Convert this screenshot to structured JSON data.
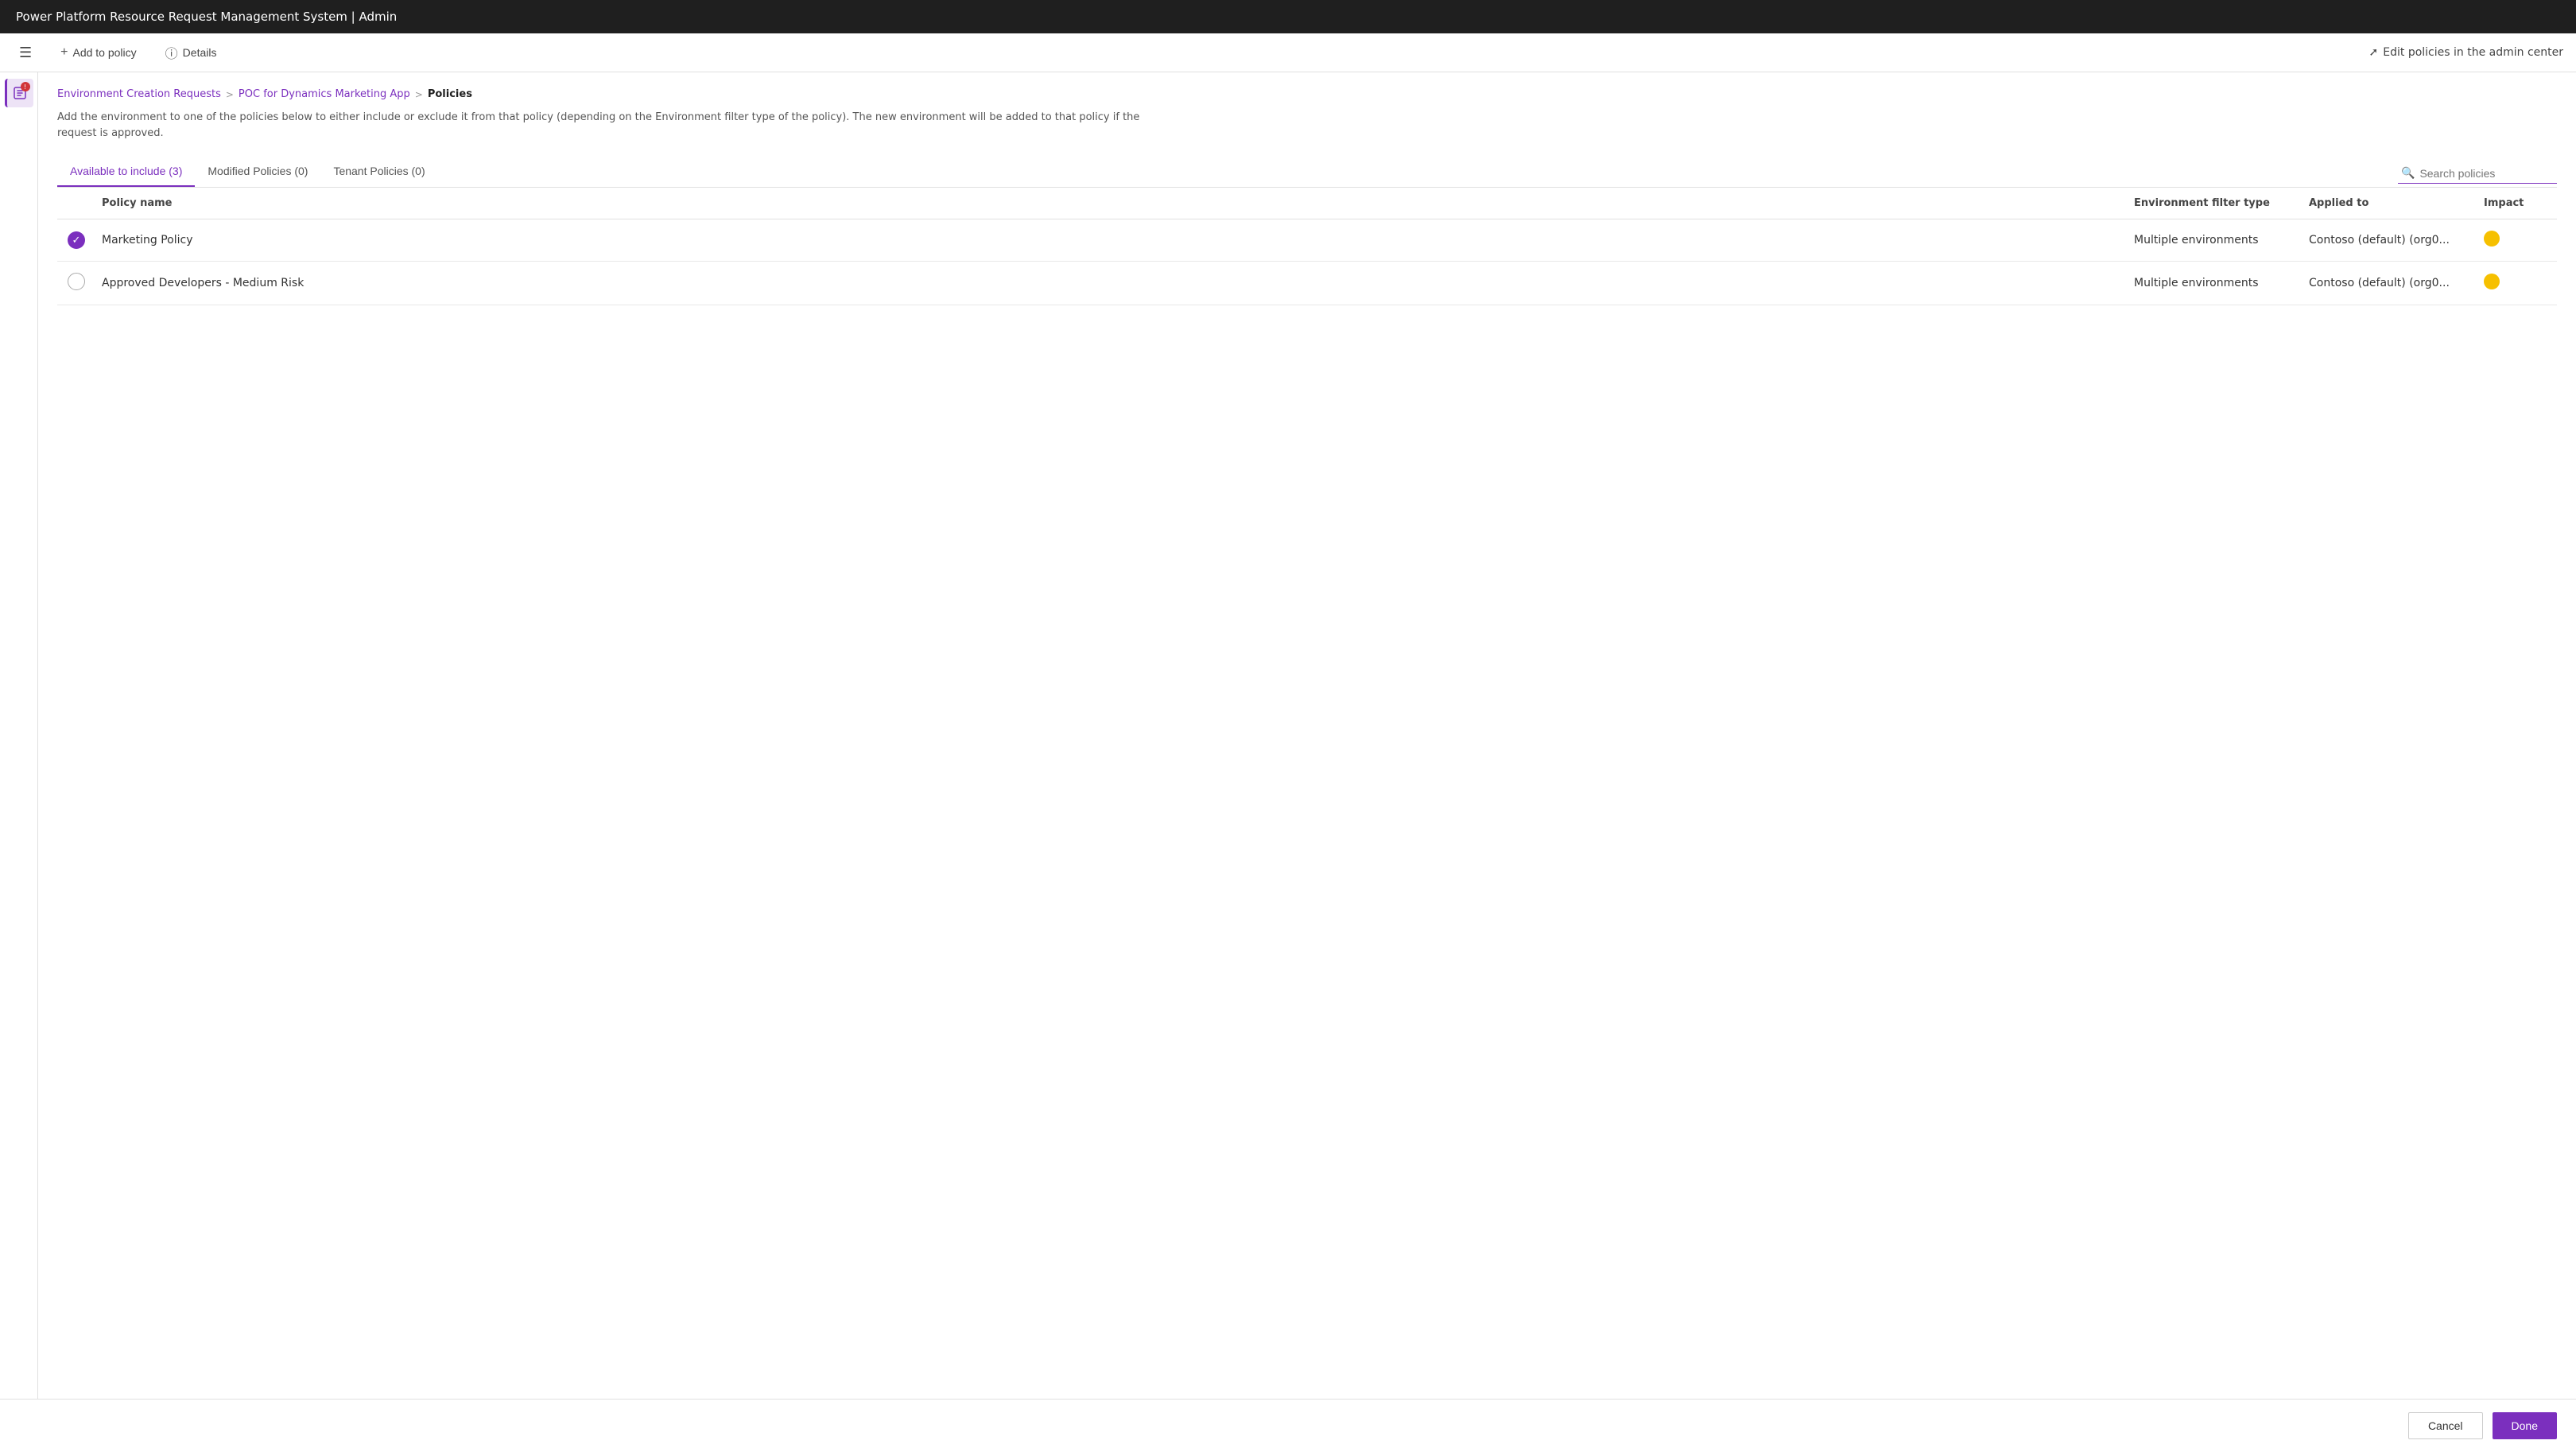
{
  "titleBar": {
    "title": "Power Platform Resource Request Management System | Admin"
  },
  "toolbar": {
    "menu_icon": "≡",
    "add_to_policy_label": "Add to policy",
    "details_label": "Details",
    "edit_link_label": "Edit policies in the admin center"
  },
  "breadcrumb": {
    "step1": "Environment Creation Requests",
    "step2": "POC for Dynamics Marketing App",
    "step3": "Policies"
  },
  "description": "Add the environment to one of the policies below to either include or exclude it from that policy (depending on the Environment filter type of the policy). The new environment will be added to that policy if the request is approved.",
  "tabs": [
    {
      "label": "Available to include (3)",
      "active": true
    },
    {
      "label": "Modified Policies (0)",
      "active": false
    },
    {
      "label": "Tenant Policies (0)",
      "active": false
    }
  ],
  "search": {
    "placeholder": "Search policies"
  },
  "table": {
    "columns": [
      {
        "id": "select",
        "label": ""
      },
      {
        "id": "policy_name",
        "label": "Policy name"
      },
      {
        "id": "filter_type",
        "label": "Environment filter type"
      },
      {
        "id": "applied_to",
        "label": "Applied to"
      },
      {
        "id": "impact",
        "label": "Impact"
      }
    ],
    "rows": [
      {
        "selected": true,
        "policy_name": "Marketing Policy",
        "filter_type": "Multiple environments",
        "applied_to": "Contoso (default) (org0...",
        "impact_color": "#f6c000"
      },
      {
        "selected": false,
        "policy_name": "Approved Developers - Medium Risk",
        "filter_type": "Multiple environments",
        "applied_to": "Contoso (default) (org0...",
        "impact_color": "#f6c000"
      }
    ]
  },
  "footer": {
    "cancel_label": "Cancel",
    "done_label": "Done"
  },
  "colors": {
    "brand_purple": "#7b2fbe",
    "impact_yellow": "#f6c000"
  }
}
